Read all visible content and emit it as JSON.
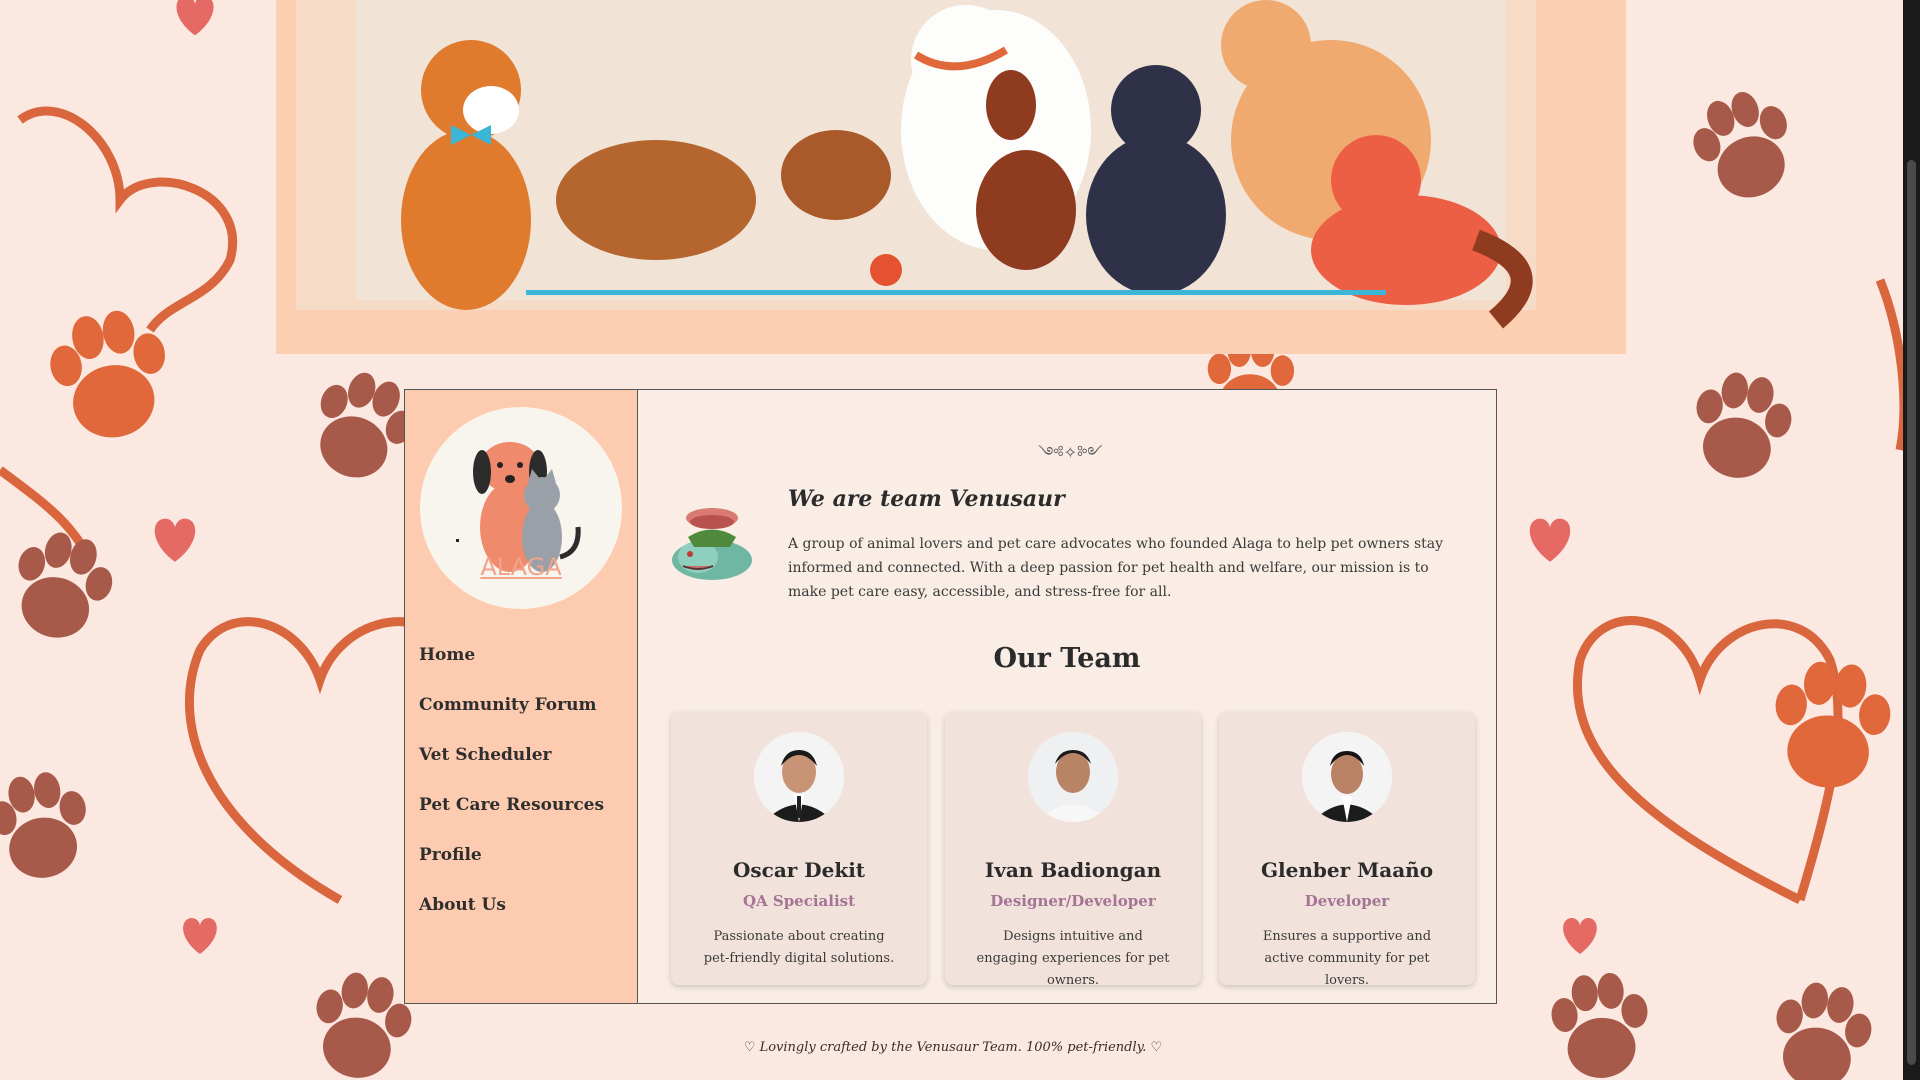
{
  "brand": {
    "logo_text": "ALAGA"
  },
  "nav": {
    "items": [
      {
        "label": "Home"
      },
      {
        "label": "Community Forum"
      },
      {
        "label": "Vet Scheduler"
      },
      {
        "label": "Pet Care Resources"
      },
      {
        "label": "Profile"
      },
      {
        "label": "About Us"
      }
    ]
  },
  "about": {
    "heading": "We are team Venusaur",
    "intro": "A group of animal lovers and pet care advocates who founded Alaga to help pet owners stay informed and connected. With a deep passion for pet health and welfare, our mission is to make pet care easy, accessible, and stress-free for all.",
    "ornament": "༺✧༻"
  },
  "team": {
    "title": "Our Team",
    "members": [
      {
        "name": "Oscar Dekit",
        "role": "QA Specialist",
        "desc": "Passionate about creating pet-friendly digital solutions."
      },
      {
        "name": "Ivan Badiongan",
        "role": "Designer/Developer",
        "desc": "Designs intuitive and engaging experiences for pet owners."
      },
      {
        "name": "Glenber Maaño",
        "role": "Developer",
        "desc": "Ensures a supportive and active community for pet lovers."
      }
    ]
  },
  "footer": {
    "text": "♡ Lovingly crafted by the Venusaur Team. 100% pet-friendly. ♡"
  },
  "colors": {
    "background": "#fbe9e1",
    "banner": "#fccfb3",
    "sidebar": "#fdcbb0",
    "panel": "#f9ede6",
    "card": "#f2e2dc",
    "role": "#a57394",
    "paw_dark": "#a85a4a",
    "paw_orange": "#e0683a",
    "heart": "#d9663d"
  },
  "icons": {
    "background": "paw-and-heart-pattern",
    "banner": "pets-group-illustration",
    "logo": "dog-and-cat-logo",
    "mascot": "venusaur-icon"
  }
}
